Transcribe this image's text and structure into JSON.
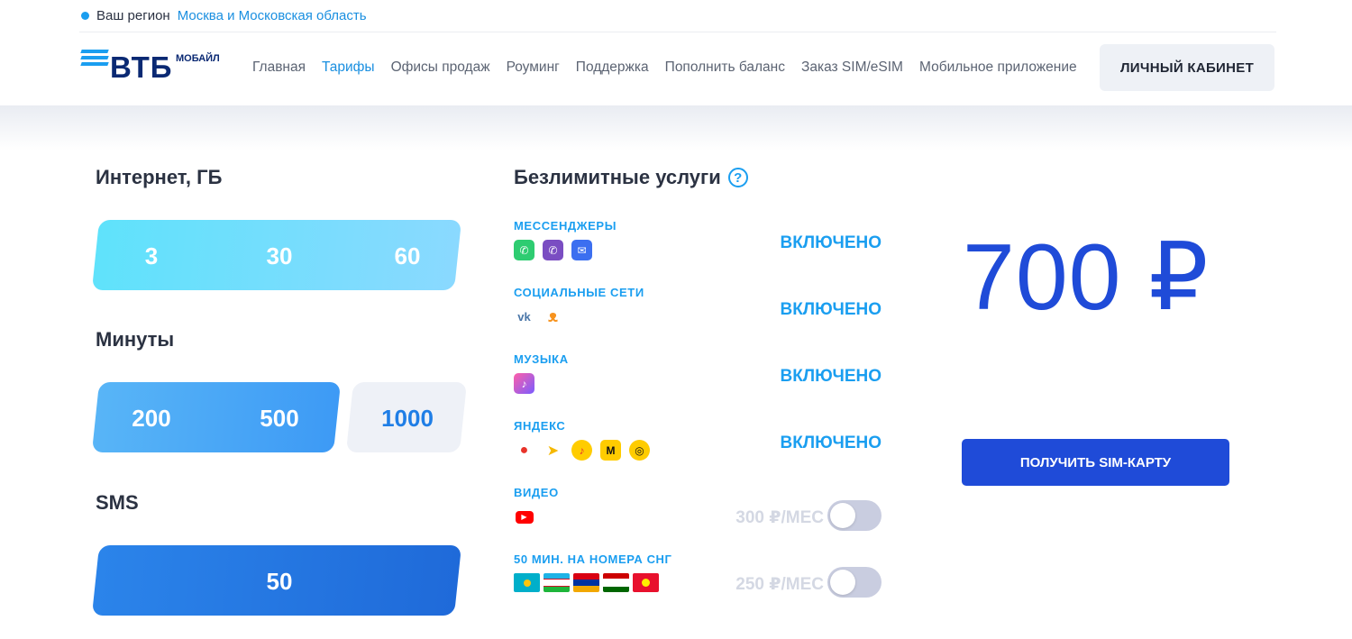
{
  "region": {
    "label": "Ваш регион",
    "value": "Москва и Московская область"
  },
  "logo": {
    "text": "ВТБ",
    "sub": "МОБАЙЛ"
  },
  "nav": [
    "Главная",
    "Тарифы",
    "Офисы продаж",
    "Роуминг",
    "Поддержка",
    "Пополнить баланс",
    "Заказ SIM/eSIM",
    "Мобильное приложение"
  ],
  "nav_active": "Тарифы",
  "cabinet_label": "ЛИЧНЫЙ КАБИНЕТ",
  "internet": {
    "title": "Интернет, ГБ",
    "options": [
      "3",
      "30",
      "60"
    ],
    "selected": "60"
  },
  "minutes": {
    "title": "Минуты",
    "options": [
      "200",
      "500",
      "1000"
    ],
    "selected": "500"
  },
  "sms": {
    "title": "SMS",
    "options": [
      "50"
    ],
    "selected": "50"
  },
  "services": {
    "title": "Безлимитные услуги",
    "items": [
      {
        "name": "МЕССЕНДЖЕРЫ",
        "status": "ВКЛЮЧЕНО",
        "icons": [
          "whatsapp-icon",
          "viber-icon",
          "messenger-icon"
        ]
      },
      {
        "name": "СОЦИАЛЬНЫЕ СЕТИ",
        "status": "ВКЛЮЧЕНО",
        "icons": [
          "vk-icon",
          "odnoklassniki-icon"
        ]
      },
      {
        "name": "МУЗЫКА",
        "status": "ВКЛЮЧЕНО",
        "icons": [
          "music-service-icon"
        ]
      },
      {
        "name": "ЯНДЕКС",
        "status": "ВКЛЮЧЕНО",
        "icons": [
          "yandex-maps-icon",
          "yandex-navigator-icon",
          "yandex-music-icon",
          "yandex-market-icon",
          "yandex-zen-icon"
        ]
      },
      {
        "name": "ВИДЕО",
        "price": "300 ₽/МЕС",
        "enabled": false,
        "icons": [
          "youtube-icon"
        ]
      },
      {
        "name": "50 МИН. НА НОМЕРА СНГ",
        "price": "250 ₽/МЕС",
        "enabled": false,
        "icons": [
          "kazakhstan-flag-icon",
          "uzbekistan-flag-icon",
          "armenia-flag-icon",
          "tajikistan-flag-icon",
          "kyrgyzstan-flag-icon"
        ]
      }
    ]
  },
  "price": "700 ₽",
  "sim_button": "ПОЛУЧИТЬ SIM-КАРТУ",
  "colors": {
    "accent": "#1a9ef0",
    "primary": "#1f4bd8",
    "brand_dark": "#0a2973"
  }
}
